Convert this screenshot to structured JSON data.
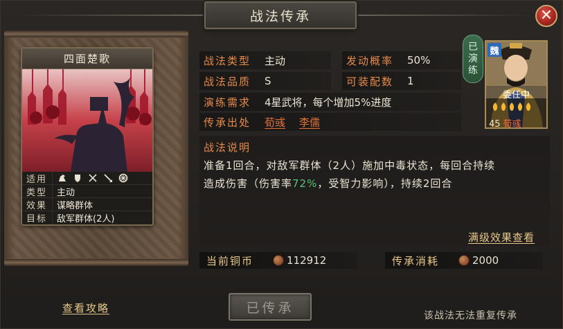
{
  "title": "战法传承",
  "close_icon": "close-icon",
  "card": {
    "name": "四面楚歌",
    "rows": [
      {
        "key": "适用",
        "value": "",
        "icons": [
          "cavalry-icon",
          "shield-icon",
          "bow-icon",
          "spear-icon",
          "wheel-icon"
        ]
      },
      {
        "key": "类型",
        "value": "主动"
      },
      {
        "key": "效果",
        "value": "谋略群体"
      },
      {
        "key": "目标",
        "value": "敌军群体(2人)"
      }
    ]
  },
  "details": {
    "type_label": "战法类型",
    "type_value": "主动",
    "rate_label": "发动概率",
    "rate_value": "50%",
    "quality_label": "战法品质",
    "quality_value": "S",
    "slots_label": "可装配数",
    "slots_value": "1",
    "req_label": "演练需求",
    "req_value": "4星武将，每个增加5%进度",
    "source_label": "传承出处",
    "sources": [
      "荀彧",
      "李儒"
    ]
  },
  "badge": {
    "text": [
      "已",
      "演",
      "练"
    ]
  },
  "hero": {
    "faction": "魏",
    "name": "委任中",
    "stars": 5,
    "level": "45",
    "hero_name": "荀彧"
  },
  "description": {
    "title": "战法说明",
    "line1": "准备1回合，对敌军群体（2人）施加中毒状态，每回合持续",
    "line2_a": "造成伤害（伤害率",
    "line2_hl": "72%",
    "line2_b": "，受智力影响），持续2回合",
    "full_effect": "满级效果查看"
  },
  "coins": {
    "current_label": "当前铜币",
    "current_value": "112912",
    "cost_label": "传承消耗",
    "cost_value": "2000"
  },
  "footer": {
    "strategy_link": "查看攻略",
    "inherit_button": "已传承",
    "note": "该战法无法重复传承"
  },
  "colors": {
    "accent_orange": "#e58a4a",
    "link_orange": "#e0703a",
    "highlight_green": "#56c776",
    "gold_link": "#e8c98a"
  }
}
